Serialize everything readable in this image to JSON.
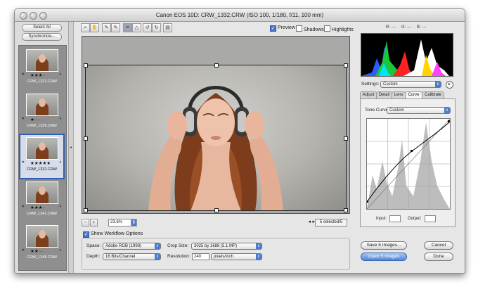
{
  "window": {
    "title": "Canon EOS 10D:  CRW_1332.CRW  (ISO 100, 1/180, f/11, 100 mm)"
  },
  "filmstrip": {
    "select_all_label": "Select All",
    "synchronize_label": "Synchronize...",
    "thumbs": [
      {
        "name": "CRW_1323.CRW",
        "stars": "★★★·",
        "selected": false
      },
      {
        "name": "CRW_1326.CRW",
        "stars": "★·····",
        "selected": false
      },
      {
        "name": "CRW_1332.CRW",
        "stars": "★★★★★",
        "selected": true
      },
      {
        "name": "CRW_1341.CRW",
        "stars": "★★★·",
        "selected": false
      },
      {
        "name": "CRW_1345.CRW",
        "stars": "★★···",
        "selected": false
      }
    ]
  },
  "toolbar": {
    "tools": [
      "zoom-tool",
      "hand-tool",
      "white-balance-tool",
      "color-sampler-tool",
      "crop-tool",
      "straighten-tool",
      "rotate-ccw",
      "rotate-cw",
      "trash"
    ],
    "preview_label": "Preview",
    "shadows_label": "Shadows",
    "highlights_label": "Highlights",
    "preview_checked": true,
    "shadows_checked": false,
    "highlights_checked": false
  },
  "readout": {
    "r": "R: ---",
    "g": "G: ---",
    "b": "B: ---"
  },
  "statusbar": {
    "zoom": "23.6%",
    "selection": "5 selected/5"
  },
  "workflow": {
    "show_label": "Show Workflow Options",
    "space_label": "Space:",
    "space_value": "Adobe RGB (1998)",
    "depth_label": "Depth:",
    "depth_value": "16 Bits/Channel",
    "crop_label": "Crop Size:",
    "crop_value": "3025 by 1688  (5.1 MP)",
    "resolution_label": "Resolution:",
    "resolution_value": "240",
    "resolution_unit": "pixels/inch"
  },
  "panel": {
    "settings_label": "Settings:",
    "settings_value": "Custom",
    "tabs": [
      "Adjust",
      "Detail",
      "Lens",
      "Curve",
      "Calibrate"
    ],
    "active_tab": "Curve",
    "tone_curve_label": "Tone Curve:",
    "tone_curve_value": "Custom",
    "input_label": "Input:",
    "output_label": "Output:"
  },
  "actions": {
    "save_label": "Save 5 Images...",
    "open_label": "Open 5 Images",
    "cancel_label": "Cancel",
    "done_label": "Done"
  },
  "colors": {
    "accent_blue": "#4f86d8",
    "selection_outline": "#2f5fb0"
  }
}
